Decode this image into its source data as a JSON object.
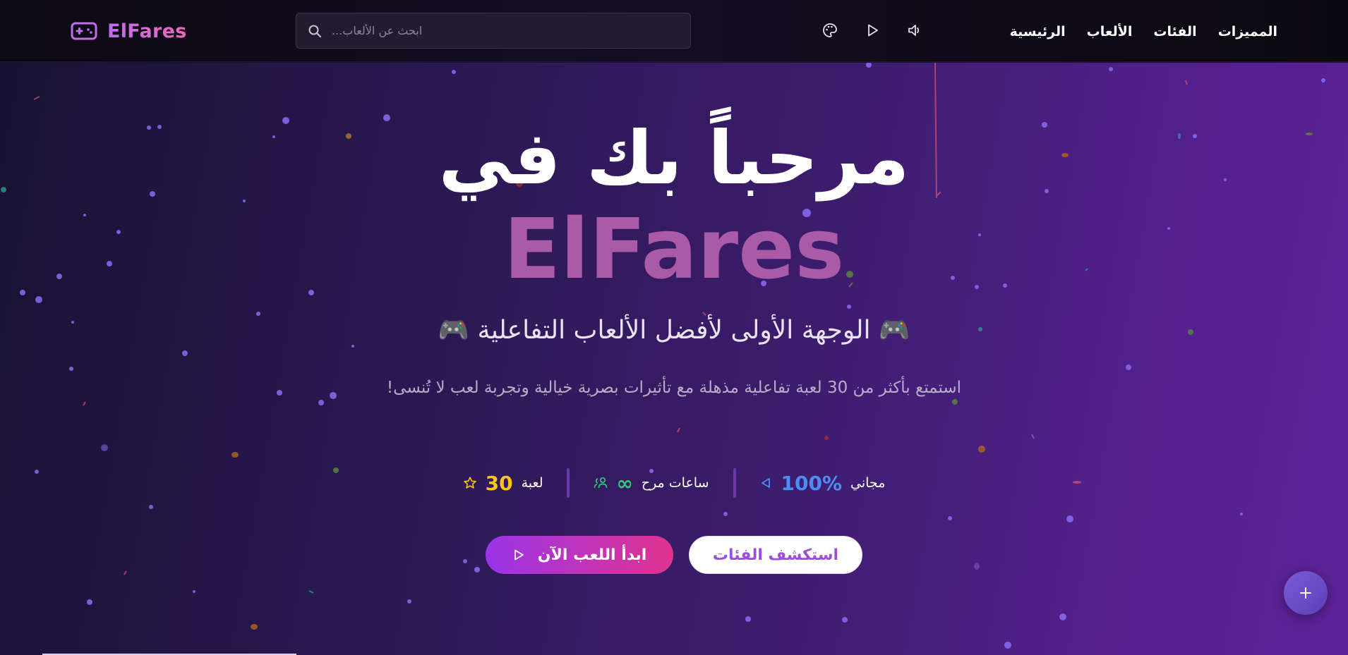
{
  "header": {
    "brand": "ElFares",
    "logo_icon": "gamepad-icon",
    "search": {
      "placeholder": "ابحث عن الألعاب...",
      "value": ""
    },
    "icons": [
      "palette-icon",
      "play-icon",
      "volume-icon"
    ],
    "nav": [
      {
        "label": "الرئيسية"
      },
      {
        "label": "الألعاب"
      },
      {
        "label": "الفئات"
      },
      {
        "label": "المميزات"
      }
    ]
  },
  "hero": {
    "title_line1": "مرحباً بك في",
    "title_line2": "ElFares",
    "tagline": "🎮 الوجهة الأولى لأفضل الألعاب التفاعلية 🎮",
    "description": "استمتع بأكثر من 30 لعبة تفاعلية مذهلة مع تأثيرات بصرية خيالية وتجربة لعب لا تُنسى!",
    "stats": [
      {
        "label": "مجاني",
        "value": "100%",
        "icon": "play-icon",
        "color": "#4d8cf5"
      },
      {
        "label": "ساعات مرح",
        "value": "∞",
        "icon": "users-icon",
        "color": "#34c77b"
      },
      {
        "label": "لعبة",
        "value": "30",
        "icon": "star-icon",
        "color": "#f5c518"
      }
    ],
    "buttons": {
      "explore": "استكشف الفئات",
      "play": "ابدأ اللعب الآن"
    }
  },
  "fab": {
    "icon": "plus-icon"
  },
  "colors": {
    "brand_gradient_start": "#c06cf0",
    "brand_gradient_end": "#ec6ab6",
    "primary_button_start": "#9a34e8",
    "primary_button_end": "#e0338f",
    "hero_bg_dark": "#171231",
    "hero_bg_light": "#5c2399"
  }
}
